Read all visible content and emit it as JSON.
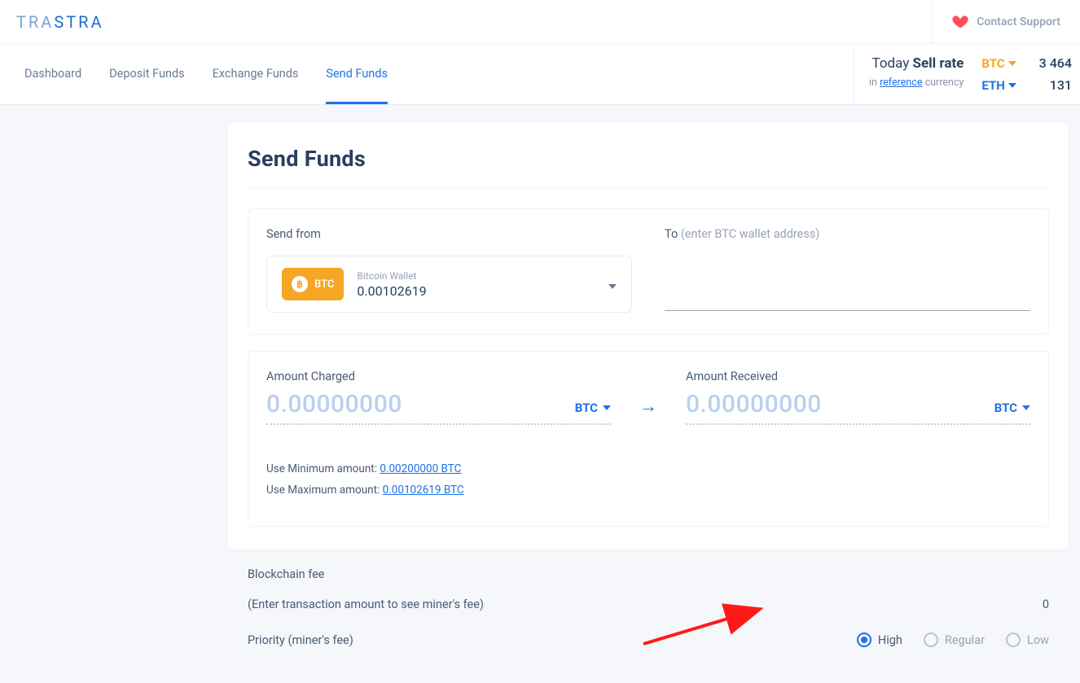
{
  "brand": {
    "left": "TRA",
    "right": "STRA"
  },
  "support": "Contact Support",
  "tabs": [
    "Dashboard",
    "Deposit Funds",
    "Exchange Funds",
    "Send Funds"
  ],
  "active_tab_index": 3,
  "rates": {
    "today_pre": "Today ",
    "today_bold": "Sell rate",
    "ref_pre": "in ",
    "ref_link": "reference",
    "ref_post": " currency",
    "list": [
      {
        "cur": "BTC",
        "cls": "btc",
        "val": "3 464"
      },
      {
        "cur": "ETH",
        "cls": "eth",
        "val": "131"
      }
    ]
  },
  "page_title": "Send Funds",
  "send_from_label": "Send from",
  "to_label": "To ",
  "to_hint": "(enter BTC wallet address)",
  "wallet": {
    "badge_cur": "BTC",
    "name": "Bitcoin Wallet",
    "balance": "0.00102619"
  },
  "amount_charged_label": "Amount Charged",
  "amount_received_label": "Amount Received",
  "amount_charged_val": "0.00000000",
  "amount_received_val": "0.00000000",
  "amount_cur": "BTC",
  "min_label": "Use Minimum amount:  ",
  "min_val": "0.00200000 BTC",
  "max_label": "Use Maximum amount:  ",
  "max_val": "0.00102619 BTC",
  "fee_section_label": "Blockchain fee",
  "fee_hint": "(Enter transaction amount to see miner's fee)",
  "fee_val": "0",
  "priority_label": "Priority (miner's fee)",
  "priority_options": [
    "High",
    "Regular",
    "Low"
  ],
  "priority_selected_index": 0
}
